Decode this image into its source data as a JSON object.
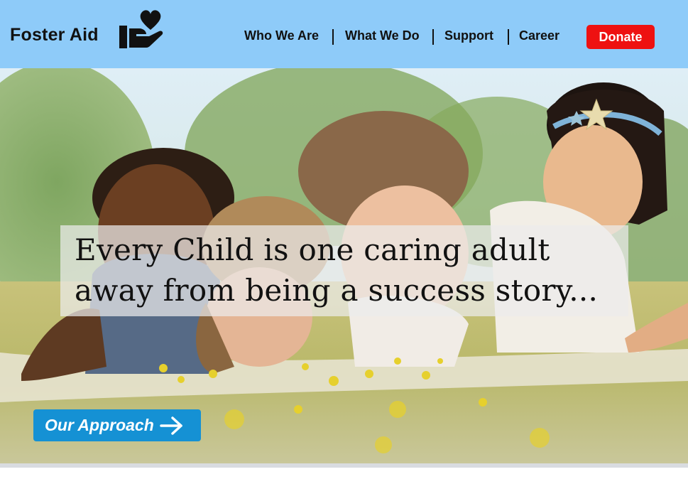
{
  "header": {
    "brand_name": "Foster Aid",
    "logo_icon": "heart-hand-icon",
    "background_color": "#8ecbf9"
  },
  "nav": {
    "items": [
      {
        "label": "Who We Are"
      },
      {
        "label": "What We Do"
      },
      {
        "label": "Support"
      },
      {
        "label": "Career"
      }
    ],
    "donate_label": "Donate",
    "donate_color": "#ee1111"
  },
  "hero": {
    "tagline_line1": "Every Child is one caring adult",
    "tagline_line2": "away from being a success story...",
    "image_subject": "children-lying-on-grass-photo",
    "cta_label": "Our Approach",
    "cta_icon": "arrow-right-icon",
    "cta_color": "#1591d4"
  }
}
